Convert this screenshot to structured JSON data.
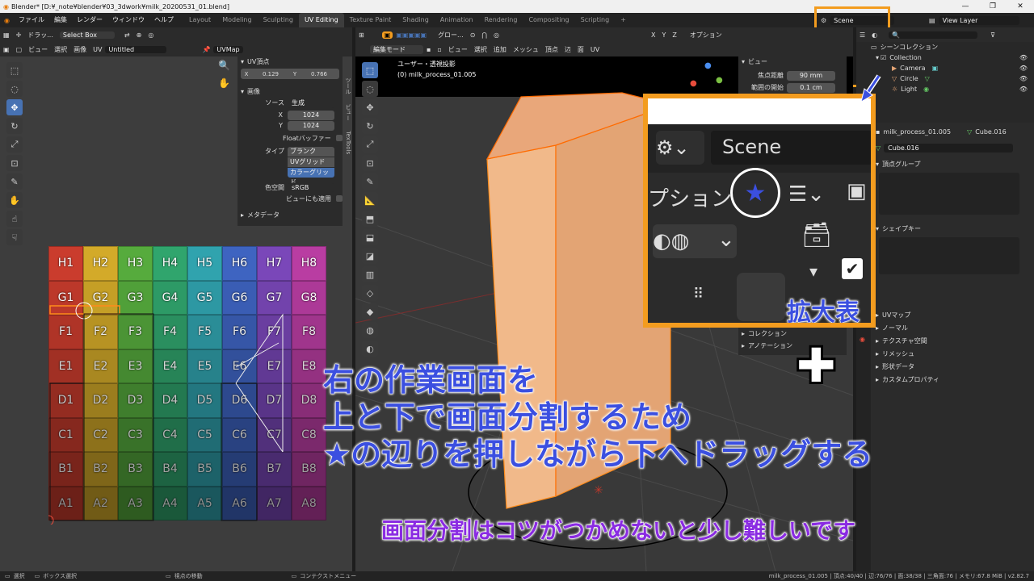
{
  "window": {
    "title": "Blender* [D:¥_note¥blender¥03_3dwork¥milk_20200531_01.blend]",
    "controls": [
      "—",
      "❐",
      "✕"
    ]
  },
  "menus": [
    "ファイル",
    "編集",
    "レンダー",
    "ウィンドウ",
    "ヘルプ"
  ],
  "workspaces": [
    "Layout",
    "Modeling",
    "Sculpting",
    "UV Editing",
    "Texture Paint",
    "Shading",
    "Animation",
    "Rendering",
    "Compositing",
    "Scripting",
    "+"
  ],
  "scene": {
    "name": "Scene",
    "view_layer": "View Layer"
  },
  "uv_editor": {
    "header": {
      "mode": "ドラッ...",
      "select": "Select Box",
      "menus": [
        "ビュー",
        "選択",
        "画像",
        "UV"
      ],
      "image": "Untitled",
      "uvmap": "UVMap"
    },
    "uv_vertex": {
      "title": "UV頂点",
      "x_label": "X",
      "x": "0.129",
      "y_label": "Y",
      "y": "0.766"
    },
    "image": {
      "title": "画像",
      "source_label": "ソース",
      "source": "生成",
      "x_label": "X",
      "x": "1024",
      "y_label": "Y",
      "y": "1024",
      "float_buffer": "Floatバッファー",
      "type_label": "タイプ",
      "types": [
        "ブランク",
        "UVグリッド",
        "カラーグリッド"
      ],
      "colorspace_label": "色空間",
      "colorspace": "sRGB",
      "view_as": "ビューにも適用"
    },
    "metadata": "メタデータ",
    "side_tabs": [
      "ツール",
      "ビュー",
      "TexTools"
    ]
  },
  "grid_labels": [
    [
      "H1",
      "H2",
      "H3",
      "H4",
      "H5",
      "H6",
      "H7",
      "H8"
    ],
    [
      "G1",
      "G2",
      "G3",
      "G4",
      "G5",
      "G6",
      "G7",
      "G8"
    ],
    [
      "F1",
      "F2",
      "F3",
      "F4",
      "F5",
      "F6",
      "F7",
      "F8"
    ],
    [
      "E1",
      "E2",
      "E3",
      "E4",
      "E5",
      "E6",
      "E7",
      "E8"
    ],
    [
      "D1",
      "D2",
      "D3",
      "D4",
      "D5",
      "D6",
      "D7",
      "D8"
    ],
    [
      "C1",
      "C2",
      "C3",
      "C4",
      "C5",
      "C6",
      "C7",
      "C8"
    ],
    [
      "B1",
      "B2",
      "B3",
      "B4",
      "B5",
      "B6",
      "B7",
      "B8"
    ],
    [
      "A1",
      "A2",
      "A3",
      "A4",
      "A5",
      "A6",
      "A7",
      "A8"
    ]
  ],
  "column_colors": [
    "#c0392b",
    "#c9a227",
    "#52a33a",
    "#2e9d68",
    "#2e9ba6",
    "#3b5fb8",
    "#7444b0",
    "#b03a9a"
  ],
  "viewport": {
    "header": {
      "transform": "グロー...",
      "options": "オプション",
      "axes": [
        "X",
        "Y",
        "Z"
      ]
    },
    "mode": "編集モード",
    "menus": [
      "ビュー",
      "選択",
      "追加",
      "メッシュ",
      "頂点",
      "辺",
      "面",
      "UV"
    ],
    "view_name": "ユーザー・透視投影",
    "object_name": "(0) milk_process_01.005",
    "n_panel": {
      "title": "ビュー",
      "focal_label": "焦点距離",
      "focal": "90 mm",
      "clip_label": "範囲の開始",
      "clip": "0.1 cm",
      "collection": "コレクション",
      "annotation": "アノテーション"
    }
  },
  "outliner": {
    "title": "シーンコレクション",
    "items": [
      "Collection",
      "Camera",
      "Circle",
      "Light"
    ]
  },
  "properties": {
    "object": "milk_process_01.005",
    "mesh": "Cube.016",
    "data_name": "Cube.016",
    "vertex_groups": "頂点グループ",
    "shape_keys": "シェイプキー",
    "sections": [
      "UVマップ",
      "ノーマル",
      "テクスチャ空間",
      "リメッシュ",
      "形状データ",
      "カスタムプロパティ"
    ]
  },
  "zoom": {
    "scene": "Scene",
    "options": "プション",
    "label": "拡大表示",
    "star": "★"
  },
  "annotation": {
    "line1": "右の作業画面を",
    "line2": "上と下で画面分割するため",
    "line3": "★の辺りを押しながら下へドラッグする",
    "note": "画面分割はコツがつかめないと少し難しいです"
  },
  "statusbar": {
    "select": "選択",
    "box": "ボックス選択",
    "move": "視点の移動",
    "context": "コンテクストメニュー",
    "stats": "milk_process_01.005 | 頂点:40/40 | 辺:76/76 | 面:38/38 | 三角面:76 | メモリ:67.8 MiB | v2.82.7"
  },
  "accent": "#f39c1f"
}
